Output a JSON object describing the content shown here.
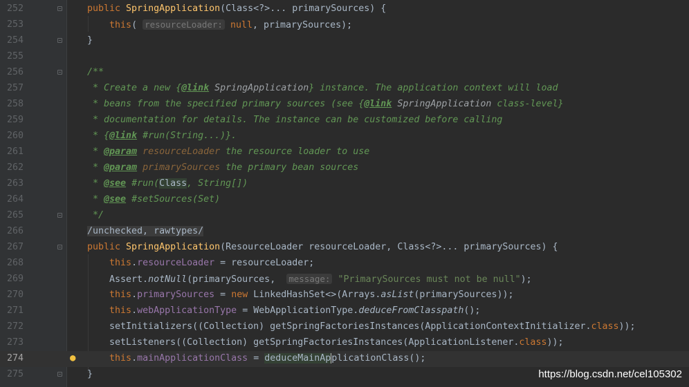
{
  "editor": {
    "lines": [
      {
        "n": "252",
        "tokens": [
          [
            "kw",
            "public "
          ],
          [
            "fn",
            "SpringApplication"
          ],
          [
            "p",
            "(Class<?>... primarySources) {"
          ]
        ]
      },
      {
        "n": "253",
        "tokens": [
          [
            "p",
            "    "
          ],
          [
            "kw",
            "this"
          ],
          [
            "p",
            "( "
          ],
          [
            "hint",
            "resourceLoader:"
          ],
          [
            "p",
            " "
          ],
          [
            "kw",
            "null"
          ],
          [
            "p",
            ", primarySources);"
          ]
        ]
      },
      {
        "n": "254",
        "tokens": [
          [
            "p",
            "}"
          ]
        ]
      },
      {
        "n": "255",
        "tokens": []
      },
      {
        "n": "256",
        "tokens": [
          [
            "doc",
            "/**"
          ]
        ]
      },
      {
        "n": "257",
        "tokens": [
          [
            "doc",
            " * Create a new {"
          ],
          [
            "doctag",
            "@link"
          ],
          [
            "docref",
            " SpringApplication"
          ],
          [
            "doc",
            "} instance. The application context will load"
          ]
        ]
      },
      {
        "n": "258",
        "tokens": [
          [
            "doc",
            " * beans from the specified primary sources (see {"
          ],
          [
            "doctag",
            "@link"
          ],
          [
            "docref",
            " SpringApplication"
          ],
          [
            "doc",
            " class-level}"
          ]
        ]
      },
      {
        "n": "259",
        "tokens": [
          [
            "doc",
            " * documentation for details. The instance can be customized before calling"
          ]
        ]
      },
      {
        "n": "260",
        "tokens": [
          [
            "doc",
            " * {"
          ],
          [
            "doctag",
            "@link"
          ],
          [
            "doc",
            " #run(String...)}."
          ]
        ]
      },
      {
        "n": "261",
        "tokens": [
          [
            "doc",
            " * "
          ],
          [
            "doctag",
            "@param"
          ],
          [
            "docparam",
            " resourceLoader"
          ],
          [
            "doc",
            " the resource loader to use"
          ]
        ]
      },
      {
        "n": "262",
        "tokens": [
          [
            "doc",
            " * "
          ],
          [
            "doctag",
            "@param"
          ],
          [
            "docparam",
            " primarySources"
          ],
          [
            "doc",
            " the primary bean sources"
          ]
        ]
      },
      {
        "n": "263",
        "tokens": [
          [
            "doc",
            " * "
          ],
          [
            "doctag",
            "@see"
          ],
          [
            "doc",
            " #run("
          ],
          [
            "hl",
            "Class"
          ],
          [
            "doc",
            ", String[])"
          ]
        ]
      },
      {
        "n": "264",
        "tokens": [
          [
            "doc",
            " * "
          ],
          [
            "doctag",
            "@see"
          ],
          [
            "doc",
            " #setSources(Set)"
          ]
        ]
      },
      {
        "n": "265",
        "tokens": [
          [
            "doc",
            " */"
          ]
        ]
      },
      {
        "n": "266",
        "tokens": [
          [
            "sup",
            "/unchecked, rawtypes/"
          ]
        ]
      },
      {
        "n": "267",
        "tokens": [
          [
            "kw",
            "public "
          ],
          [
            "fn",
            "SpringApplication"
          ],
          [
            "p",
            "(ResourceLoader resourceLoader, Class<?>... primarySources) {"
          ]
        ]
      },
      {
        "n": "268",
        "tokens": [
          [
            "p",
            "    "
          ],
          [
            "kw",
            "this"
          ],
          [
            "p",
            "."
          ],
          [
            "field",
            "resourceLoader"
          ],
          [
            "p",
            " = resourceLoader;"
          ]
        ]
      },
      {
        "n": "269",
        "tokens": [
          [
            "p",
            "    Assert."
          ],
          [
            "static",
            "notNull"
          ],
          [
            "p",
            "(primarySources,  "
          ],
          [
            "hint",
            "message:"
          ],
          [
            "p",
            " "
          ],
          [
            "str",
            "\"PrimarySources must not be null\""
          ],
          [
            "p",
            ");"
          ]
        ]
      },
      {
        "n": "270",
        "tokens": [
          [
            "p",
            "    "
          ],
          [
            "kw",
            "this"
          ],
          [
            "p",
            "."
          ],
          [
            "field",
            "primarySources"
          ],
          [
            "p",
            " = "
          ],
          [
            "kw",
            "new"
          ],
          [
            "p",
            " LinkedHashSet<>(Arrays."
          ],
          [
            "static",
            "asList"
          ],
          [
            "p",
            "(primarySources));"
          ]
        ]
      },
      {
        "n": "271",
        "tokens": [
          [
            "p",
            "    "
          ],
          [
            "kw",
            "this"
          ],
          [
            "p",
            "."
          ],
          [
            "field",
            "webApplicationType"
          ],
          [
            "p",
            " = WebApplicationType."
          ],
          [
            "static",
            "deduceFromClasspath"
          ],
          [
            "p",
            "();"
          ]
        ]
      },
      {
        "n": "272",
        "tokens": [
          [
            "p",
            "    setInitializers((Collection) getSpringFactoriesInstances(ApplicationContextInitializer."
          ],
          [
            "kw",
            "class"
          ],
          [
            "p",
            "));"
          ]
        ]
      },
      {
        "n": "273",
        "tokens": [
          [
            "p",
            "    setListeners((Collection) getSpringFactoriesInstances(ApplicationListener."
          ],
          [
            "kw",
            "class"
          ],
          [
            "p",
            "));"
          ]
        ]
      },
      {
        "n": "274",
        "tokens": [
          [
            "p",
            "    "
          ],
          [
            "kw",
            "this"
          ],
          [
            "p",
            "."
          ],
          [
            "field",
            "mainApplicationClass"
          ],
          [
            "p",
            " = "
          ],
          [
            "hl",
            "deduceMainAp"
          ],
          [
            "caret",
            "plicationClass"
          ],
          [
            "p",
            "();"
          ]
        ],
        "current": true
      },
      {
        "n": "275",
        "tokens": [
          [
            "p",
            "}"
          ]
        ]
      }
    ]
  },
  "watermark": "https://blog.csdn.net/cel105302",
  "colors": {
    "background": "#2b2b2b",
    "keyword": "#cc7832",
    "method": "#ffc66d",
    "field": "#9876aa",
    "string": "#6a8759",
    "doc": "#629755"
  },
  "icons": {
    "intention": "lightbulb-icon"
  }
}
